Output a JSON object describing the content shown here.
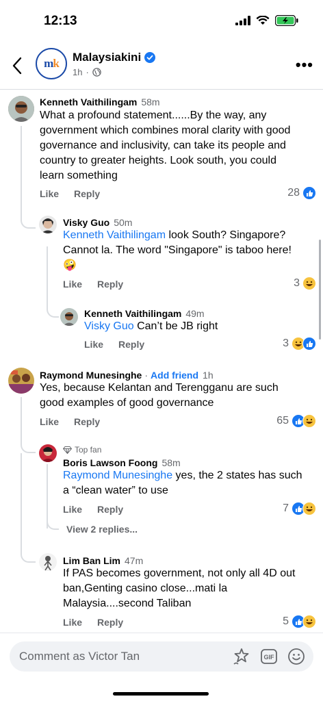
{
  "status_bar": {
    "time": "12:13"
  },
  "header": {
    "page_name": "Malaysiakini",
    "post_time": "1h",
    "logo_text_a": "m",
    "logo_text_b": "k"
  },
  "comments": [
    {
      "author": "Kenneth Vaithilingam",
      "time": "58m",
      "lines": [
        "What a profound statement......By the way, any",
        "government which combines moral clarity with good",
        "governance and inclusivity, can take its people and",
        "country to greater heights. Look south, you could",
        "learn something"
      ],
      "like": "Like",
      "reply": "Reply",
      "reaction_count": "28"
    },
    {
      "author": "Visky Guo",
      "time": "50m",
      "mention": "Kenneth Vaithilingam",
      "line1_rest": " look South? Singapore?",
      "line2": "Cannot la. The word \"Singapore\" is taboo here!",
      "emoji": "🤪",
      "like": "Like",
      "reply": "Reply",
      "reaction_count": "3"
    },
    {
      "author": "Kenneth Vaithilingam",
      "time": "49m",
      "mention": "Visky Guo",
      "rest": " Can’t be JB right",
      "like": "Like",
      "reply": "Reply",
      "reaction_count": "3"
    },
    {
      "author": "Raymond Munesinghe",
      "add_friend": "Add friend",
      "time": "1h",
      "lines": [
        "Yes, because Kelantan and Terengganu are such",
        "good examples of good governance"
      ],
      "like": "Like",
      "reply": "Reply",
      "reaction_count": "65"
    },
    {
      "badge": "Top fan",
      "author": "Boris Lawson Foong",
      "time": "58m",
      "mention": "Raymond Munesinghe",
      "line1_rest": " yes, the 2 states has such",
      "line2": "a “clean water” to use",
      "like": "Like",
      "reply": "Reply",
      "reaction_count": "7",
      "view_replies": "View 2 replies..."
    },
    {
      "author": "Lim Ban Lim",
      "time": "47m",
      "lines": [
        "If PAS becomes government,  not only all 4D out",
        "ban,Genting casino close...mati la",
        "Malaysia....second Taliban"
      ],
      "like": "Like",
      "reply": "Reply",
      "reaction_count": "5"
    }
  ],
  "composer": {
    "placeholder": "Comment as Victor Tan",
    "gif_label": "GIF"
  },
  "icons": [
    "signal-icon",
    "wifi-icon",
    "battery-icon",
    "back-icon",
    "verified-icon",
    "globe-icon",
    "more-icon",
    "like-reaction-icon",
    "haha-reaction-icon",
    "diamond-icon",
    "sticker-icon",
    "gif-icon",
    "emoji-icon"
  ],
  "colors": {
    "link": "#1877f2",
    "secondary": "#65676b",
    "battery": "#34c759"
  }
}
